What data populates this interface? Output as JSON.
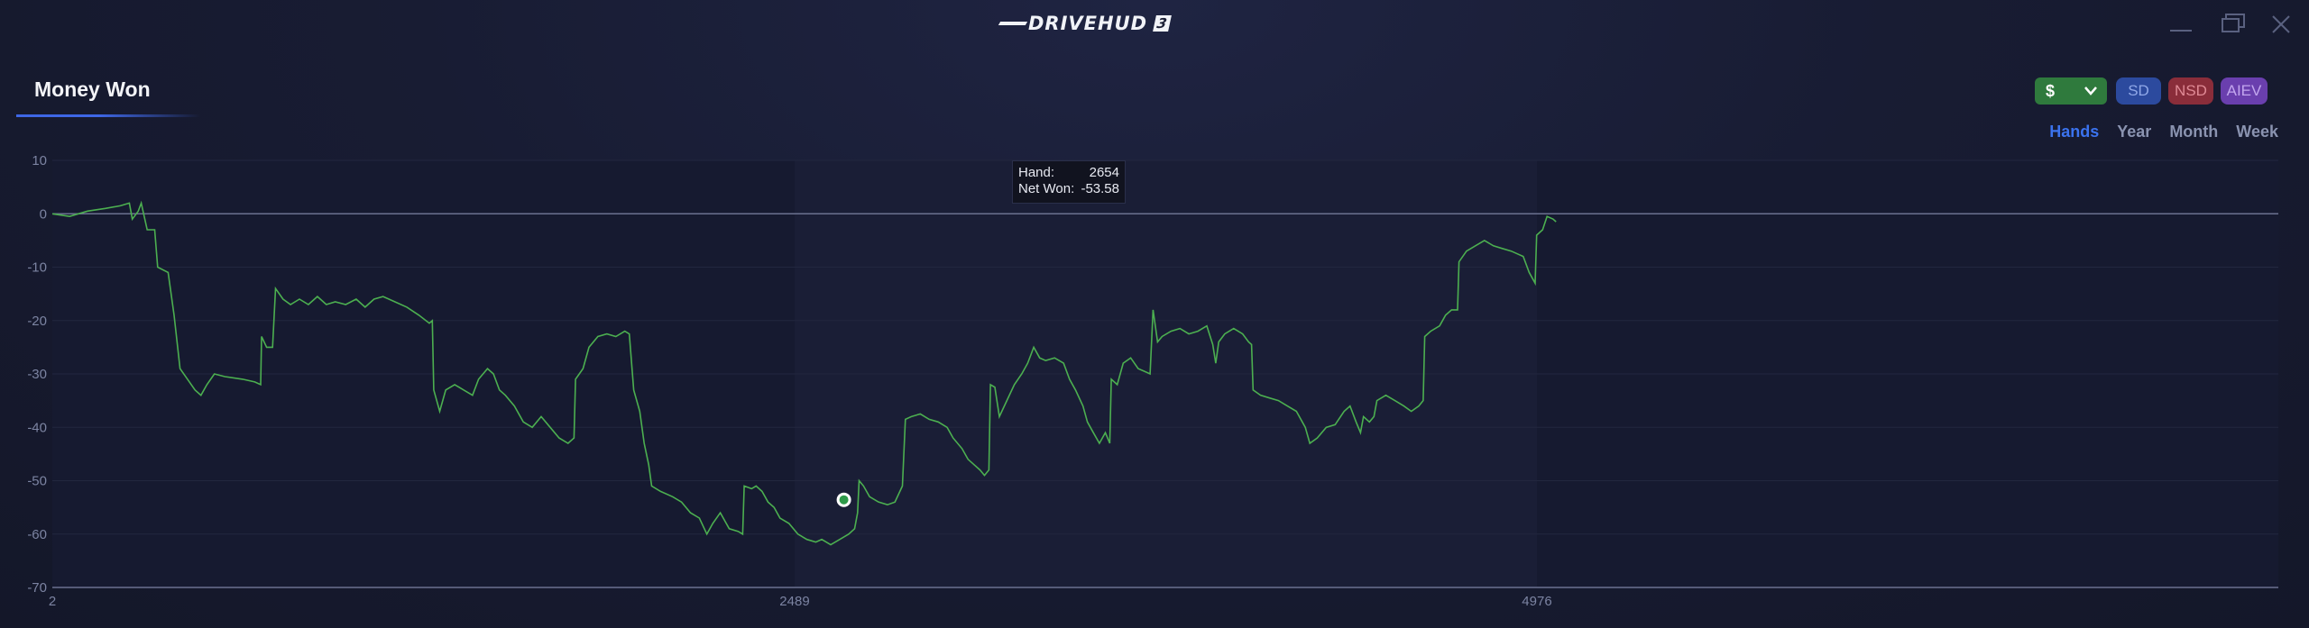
{
  "window": {
    "logo_text": "DRIVEHUD",
    "logo_badge": "3"
  },
  "panel": {
    "title": "Money Won"
  },
  "controls": {
    "currency": "$",
    "buttons": [
      "SD",
      "NSD",
      "AIEV"
    ],
    "ranges": [
      "Hands",
      "Year",
      "Month",
      "Week"
    ],
    "active_range": "Hands"
  },
  "colors": {
    "accent": "#3b73ee",
    "line": "#4caf50",
    "sd": "#2c4a9e",
    "nsd": "#8a2d3a",
    "aiev": "#6a3fae",
    "currency": "#2f7a3d"
  },
  "tooltip": {
    "hand_label": "Hand:",
    "hand_value": "2654",
    "net_label": "Net Won:",
    "net_value": "-53.58"
  },
  "chart_data": {
    "type": "line",
    "title": "Money Won",
    "xlabel": "",
    "ylabel": "",
    "xlim": [
      2,
      7460
    ],
    "ylim": [
      -70,
      10
    ],
    "yticks": [
      10,
      0,
      -10,
      -20,
      -30,
      -40,
      -50,
      -60,
      -70
    ],
    "xticks": [
      2,
      2489,
      4976
    ],
    "grid": true,
    "highlight": {
      "x": 2654,
      "y": -53.58
    },
    "series": [
      {
        "values_xy": [
          [
            2,
            0
          ],
          [
            60,
            -0.5
          ],
          [
            120,
            0.5
          ],
          [
            180,
            1
          ],
          [
            230,
            1.5
          ],
          [
            260,
            2
          ],
          [
            270,
            -1
          ],
          [
            290,
            0.5
          ],
          [
            300,
            2
          ],
          [
            320,
            -3
          ],
          [
            345,
            -3
          ],
          [
            355,
            -10
          ],
          [
            390,
            -11
          ],
          [
            410,
            -19
          ],
          [
            430,
            -29
          ],
          [
            455,
            -31
          ],
          [
            480,
            -33
          ],
          [
            500,
            -34
          ],
          [
            520,
            -32
          ],
          [
            545,
            -30
          ],
          [
            580,
            -30.5
          ],
          [
            640,
            -31
          ],
          [
            680,
            -31.5
          ],
          [
            700,
            -32
          ],
          [
            703,
            -23
          ],
          [
            720,
            -25
          ],
          [
            740,
            -25
          ],
          [
            750,
            -14
          ],
          [
            775,
            -16
          ],
          [
            800,
            -17
          ],
          [
            830,
            -16
          ],
          [
            860,
            -17
          ],
          [
            890,
            -15.5
          ],
          [
            920,
            -17
          ],
          [
            950,
            -16.5
          ],
          [
            985,
            -17
          ],
          [
            1020,
            -16
          ],
          [
            1050,
            -17.5
          ],
          [
            1080,
            -16
          ],
          [
            1110,
            -15.5
          ],
          [
            1150,
            -16.5
          ],
          [
            1190,
            -17.5
          ],
          [
            1230,
            -19
          ],
          [
            1265,
            -20.5
          ],
          [
            1275,
            -20
          ],
          [
            1280,
            -33
          ],
          [
            1300,
            -37
          ],
          [
            1320,
            -33
          ],
          [
            1350,
            -32
          ],
          [
            1380,
            -33
          ],
          [
            1410,
            -34
          ],
          [
            1430,
            -31
          ],
          [
            1460,
            -29
          ],
          [
            1480,
            -30
          ],
          [
            1500,
            -33
          ],
          [
            1520,
            -34
          ],
          [
            1550,
            -36
          ],
          [
            1580,
            -39
          ],
          [
            1610,
            -40
          ],
          [
            1640,
            -38
          ],
          [
            1670,
            -40
          ],
          [
            1700,
            -42
          ],
          [
            1730,
            -43
          ],
          [
            1750,
            -42
          ],
          [
            1755,
            -31
          ],
          [
            1780,
            -29
          ],
          [
            1800,
            -25
          ],
          [
            1830,
            -23
          ],
          [
            1860,
            -22.5
          ],
          [
            1890,
            -23
          ],
          [
            1920,
            -22
          ],
          [
            1935,
            -22.5
          ],
          [
            1950,
            -33
          ],
          [
            1970,
            -37
          ],
          [
            1985,
            -43
          ],
          [
            2000,
            -47
          ],
          [
            2010,
            -51
          ],
          [
            2040,
            -52
          ],
          [
            2080,
            -53
          ],
          [
            2110,
            -54
          ],
          [
            2140,
            -56
          ],
          [
            2170,
            -57
          ],
          [
            2195,
            -60
          ],
          [
            2215,
            -58
          ],
          [
            2240,
            -56
          ],
          [
            2270,
            -59
          ],
          [
            2300,
            -59.5
          ],
          [
            2315,
            -60
          ],
          [
            2320,
            -51
          ],
          [
            2345,
            -51.5
          ],
          [
            2360,
            -51
          ],
          [
            2380,
            -52
          ],
          [
            2400,
            -54
          ],
          [
            2420,
            -55
          ],
          [
            2440,
            -57
          ],
          [
            2470,
            -58
          ],
          [
            2500,
            -60
          ],
          [
            2530,
            -61
          ],
          [
            2560,
            -61.5
          ],
          [
            2580,
            -61
          ],
          [
            2610,
            -62
          ],
          [
            2640,
            -61
          ],
          [
            2670,
            -60
          ],
          [
            2690,
            -59
          ],
          [
            2700,
            -56
          ],
          [
            2705,
            -50
          ],
          [
            2720,
            -51
          ],
          [
            2740,
            -53
          ],
          [
            2770,
            -54
          ],
          [
            2800,
            -54.5
          ],
          [
            2825,
            -54
          ],
          [
            2850,
            -51
          ],
          [
            2860,
            -38.5
          ],
          [
            2880,
            -38
          ],
          [
            2910,
            -37.5
          ],
          [
            2940,
            -38.5
          ],
          [
            2970,
            -39
          ],
          [
            3000,
            -40
          ],
          [
            3020,
            -42
          ],
          [
            3050,
            -44
          ],
          [
            3070,
            -46
          ],
          [
            3090,
            -47
          ],
          [
            3110,
            -48
          ],
          [
            3125,
            -49
          ],
          [
            3140,
            -48
          ],
          [
            3145,
            -32
          ],
          [
            3160,
            -32.5
          ],
          [
            3175,
            -38
          ],
          [
            3200,
            -35
          ],
          [
            3225,
            -32
          ],
          [
            3250,
            -30
          ],
          [
            3270,
            -28
          ],
          [
            3290,
            -25
          ],
          [
            3310,
            -27
          ],
          [
            3330,
            -27.5
          ],
          [
            3360,
            -27
          ],
          [
            3390,
            -28
          ],
          [
            3410,
            -31
          ],
          [
            3430,
            -33
          ],
          [
            3455,
            -36
          ],
          [
            3470,
            -39
          ],
          [
            3490,
            -41
          ],
          [
            3510,
            -43
          ],
          [
            3530,
            -41
          ],
          [
            3545,
            -43
          ],
          [
            3550,
            -31
          ],
          [
            3570,
            -32
          ],
          [
            3590,
            -28
          ],
          [
            3615,
            -27
          ],
          [
            3640,
            -29
          ],
          [
            3660,
            -29.5
          ],
          [
            3680,
            -30
          ],
          [
            3690,
            -18
          ],
          [
            3705,
            -24
          ],
          [
            3720,
            -23
          ],
          [
            3750,
            -22
          ],
          [
            3780,
            -21.5
          ],
          [
            3810,
            -22.5
          ],
          [
            3840,
            -22
          ],
          [
            3870,
            -21
          ],
          [
            3890,
            -24.5
          ],
          [
            3900,
            -28
          ],
          [
            3910,
            -24
          ],
          [
            3930,
            -22.5
          ],
          [
            3960,
            -21.5
          ],
          [
            3990,
            -22.5
          ],
          [
            4010,
            -24
          ],
          [
            4020,
            -24.5
          ],
          [
            4025,
            -33
          ],
          [
            4050,
            -34
          ],
          [
            4080,
            -34.5
          ],
          [
            4110,
            -35
          ],
          [
            4140,
            -36
          ],
          [
            4170,
            -37
          ],
          [
            4200,
            -40
          ],
          [
            4215,
            -43
          ],
          [
            4240,
            -42
          ],
          [
            4270,
            -40
          ],
          [
            4300,
            -39.5
          ],
          [
            4330,
            -37
          ],
          [
            4350,
            -36
          ],
          [
            4370,
            -39
          ],
          [
            4385,
            -41
          ],
          [
            4395,
            -38
          ],
          [
            4415,
            -39
          ],
          [
            4430,
            -38
          ],
          [
            4440,
            -35
          ],
          [
            4470,
            -34
          ],
          [
            4500,
            -35
          ],
          [
            4530,
            -36
          ],
          [
            4555,
            -37
          ],
          [
            4580,
            -36
          ],
          [
            4595,
            -35
          ],
          [
            4600,
            -23
          ],
          [
            4620,
            -22
          ],
          [
            4650,
            -21
          ],
          [
            4670,
            -19
          ],
          [
            4690,
            -18
          ],
          [
            4710,
            -18
          ],
          [
            4715,
            -9
          ],
          [
            4740,
            -7
          ],
          [
            4770,
            -6
          ],
          [
            4800,
            -5
          ],
          [
            4830,
            -6
          ],
          [
            4860,
            -6.5
          ],
          [
            4890,
            -7
          ],
          [
            4910,
            -7.5
          ],
          [
            4930,
            -8
          ],
          [
            4950,
            -11
          ],
          [
            4970,
            -13
          ],
          [
            4975,
            -4
          ],
          [
            4995,
            -3
          ],
          [
            5010,
            -0.5
          ],
          [
            5030,
            -1
          ],
          [
            5040,
            -1.5
          ]
        ]
      }
    ]
  }
}
